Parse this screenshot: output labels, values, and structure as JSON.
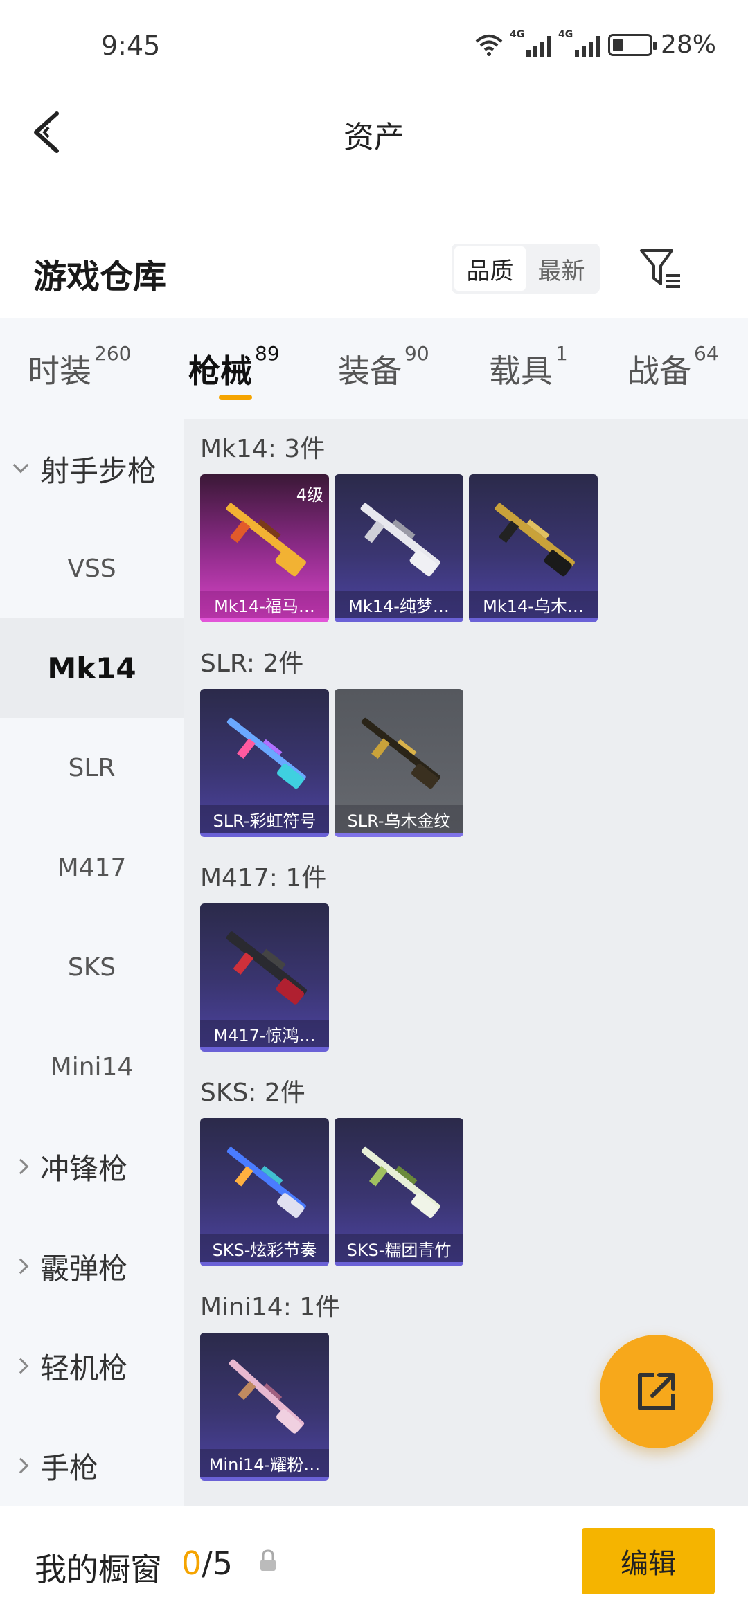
{
  "status_bar": {
    "time": "9:45",
    "network_1": "4G",
    "network_2": "4G",
    "battery": "28%"
  },
  "header": {
    "title": "资产"
  },
  "warehouse": {
    "title": "游戏仓库",
    "sort_options": [
      "品质",
      "最新"
    ],
    "sort_active": "品质"
  },
  "categories": [
    {
      "label": "时装",
      "count": "260"
    },
    {
      "label": "枪械",
      "count": "89"
    },
    {
      "label": "装备",
      "count": "90"
    },
    {
      "label": "载具",
      "count": "1"
    },
    {
      "label": "战备",
      "count": "64"
    }
  ],
  "active_category": "枪械",
  "sidebar": {
    "group_open": "射手步枪",
    "subitems": [
      "VSS",
      "Mk14",
      "SLR",
      "M417",
      "SKS",
      "Mini14"
    ],
    "active_subitem": "Mk14",
    "groups_closed": [
      "冲锋枪",
      "霰弹枪",
      "轻机枪",
      "手枪"
    ]
  },
  "sections": [
    {
      "title": "Mk14: 3件",
      "items": [
        {
          "label": "Mk14-福马…",
          "level": "4级",
          "style": "pink"
        },
        {
          "label": "Mk14-纯梦…",
          "style": "purple"
        },
        {
          "label": "Mk14-乌木…",
          "style": "purple"
        }
      ]
    },
    {
      "title": "SLR: 2件",
      "items": [
        {
          "label": "SLR-彩虹符号",
          "style": "purple"
        },
        {
          "label": "SLR-乌木金纹",
          "style": "gray"
        }
      ]
    },
    {
      "title": "M417: 1件",
      "items": [
        {
          "label": "M417-惊鸿…",
          "style": "purple"
        }
      ]
    },
    {
      "title": "SKS: 2件",
      "items": [
        {
          "label": "SKS-炫彩节奏",
          "style": "purple"
        },
        {
          "label": "SKS-糯团青竹",
          "style": "purple"
        }
      ]
    },
    {
      "title": "Mini14: 1件",
      "items": [
        {
          "label": "Mini14-耀粉…",
          "style": "purple"
        }
      ]
    }
  ],
  "showcase": {
    "title": "我的橱窗",
    "used": "0",
    "total": "/5"
  },
  "edit_button": {
    "label": "编辑"
  },
  "colors": {
    "accent": "#f5a400",
    "fab": "#f7a81b",
    "card_purple": "#3a3570",
    "card_pink": "#d845c7"
  },
  "icons": {
    "back": "chevron-left-icon",
    "filter": "filter-icon",
    "fab": "share-external-icon",
    "lock": "lock-icon"
  }
}
